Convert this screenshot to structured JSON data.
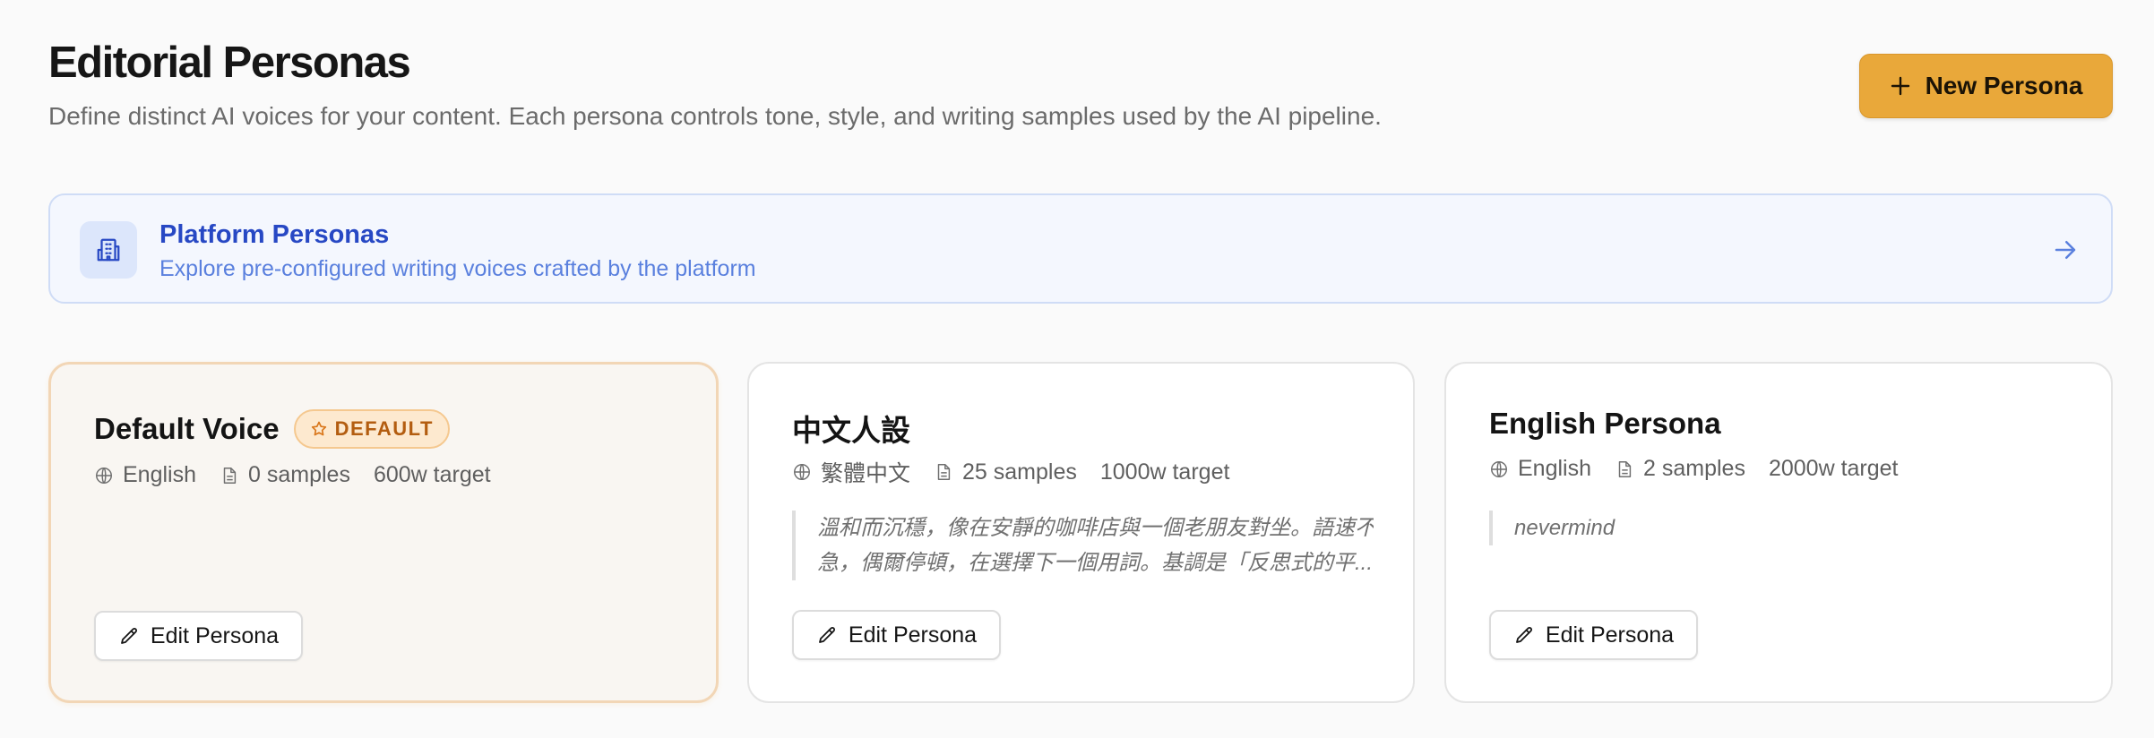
{
  "header": {
    "title": "Editorial Personas",
    "subtitle": "Define distinct AI voices for your content. Each persona controls tone, style, and writing samples used by the AI pipeline.",
    "new_button_label": "New Persona"
  },
  "platform_banner": {
    "title": "Platform Personas",
    "description": "Explore pre-configured writing voices crafted by the platform",
    "icon": "building-icon",
    "arrow_icon": "arrow-right-icon"
  },
  "personas": [
    {
      "name": "Default Voice",
      "badge": "DEFAULT",
      "language": "English",
      "samples": "0 samples",
      "target": "600w target",
      "description_lines": [],
      "edit_label": "Edit Persona"
    },
    {
      "name": "中文人設",
      "badge": "",
      "language": "繁體中文",
      "samples": "25 samples",
      "target": "1000w target",
      "description_lines": [
        "溫和而沉穩，像在安靜的咖啡店與一個老朋友對坐。語速不",
        "急，偶爾停頓，在選擇下一個用詞。基調是「反思式的平..."
      ],
      "edit_label": "Edit Persona"
    },
    {
      "name": "English Persona",
      "badge": "",
      "language": "English",
      "samples": "2 samples",
      "target": "2000w target",
      "description_lines": [
        "nevermind"
      ],
      "edit_label": "Edit Persona"
    }
  ],
  "colors": {
    "accent": "#e9a83a",
    "banner_title": "#2748c4",
    "banner_text": "#5a80de",
    "badge_text": "#b35d10"
  }
}
